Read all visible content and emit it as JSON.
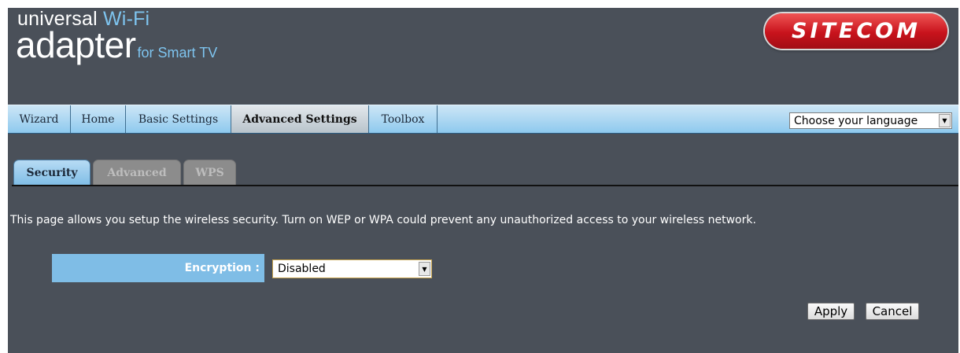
{
  "logo": {
    "line1_a": "universal",
    "line1_b": "Wi-Fi",
    "line2_main": "adapter",
    "line2_sub": "for Smart TV"
  },
  "brand": {
    "name": "SITECOM"
  },
  "nav": {
    "items": [
      {
        "label": "Wizard"
      },
      {
        "label": "Home"
      },
      {
        "label": "Basic Settings"
      },
      {
        "label": "Advanced Settings",
        "active": true
      },
      {
        "label": "Toolbox"
      }
    ],
    "language_select": "Choose your language"
  },
  "tabs": [
    {
      "label": "Security",
      "active": true
    },
    {
      "label": "Advanced",
      "active": false
    },
    {
      "label": "WPS",
      "active": false
    }
  ],
  "description": "This page allows you setup the wireless security. Turn on WEP or WPA could prevent any unauthorized access to your wireless network.",
  "form": {
    "encryption_label": "Encryption :",
    "encryption_value": "Disabled"
  },
  "buttons": {
    "apply": "Apply",
    "cancel": "Cancel"
  },
  "colors": {
    "background": "#4a5059",
    "nav_blue": "#8ec9ee",
    "brand_red": "#c8131c",
    "accent_blue": "#7fbde6"
  }
}
